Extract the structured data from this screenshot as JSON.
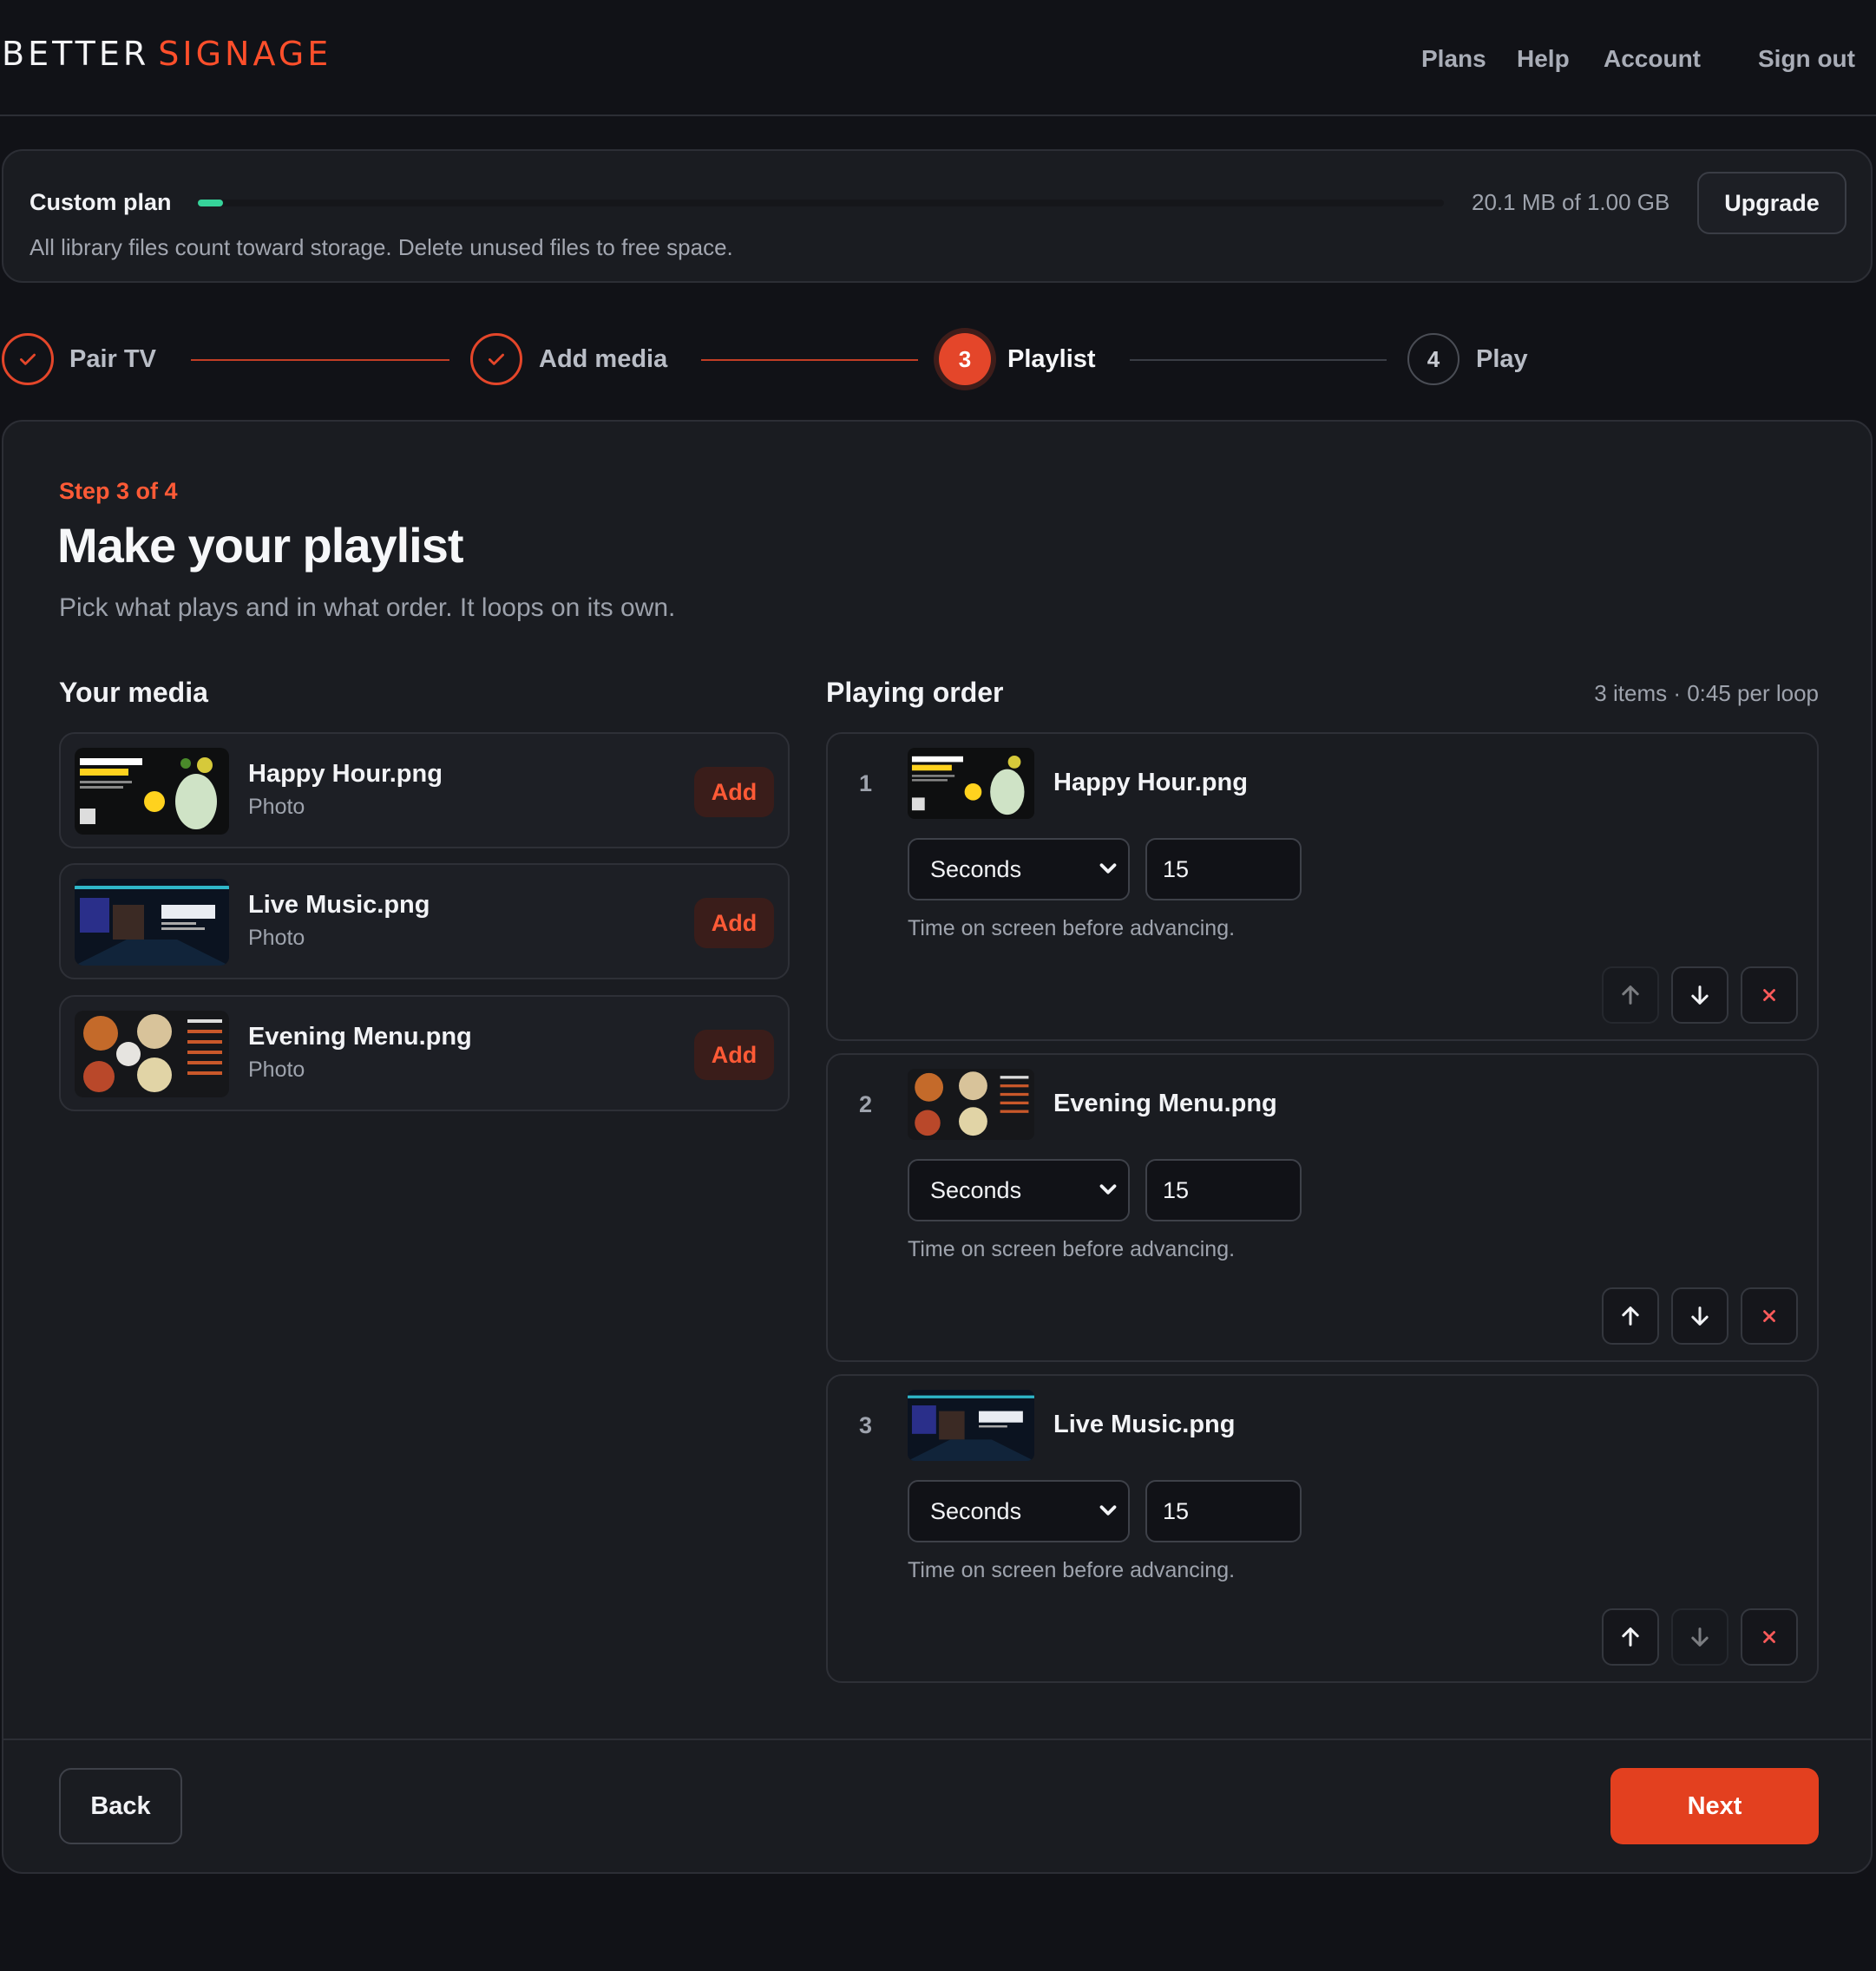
{
  "header": {
    "logo_left": "BETTER",
    "logo_right": "SIGNAGE",
    "nav": [
      "Plans",
      "Help",
      "Account",
      "Sign out"
    ]
  },
  "plan": {
    "name": "Custom plan",
    "usage_text": "20.1 MB of 1.00 GB",
    "usage_fraction": 0.02,
    "upgrade_label": "Upgrade",
    "note": "All library files count toward storage. Delete unused files to free space."
  },
  "stepper": {
    "steps": [
      {
        "label": "Pair TV",
        "state": "done",
        "icon": "check-icon"
      },
      {
        "label": "Add media",
        "state": "done",
        "icon": "check-icon"
      },
      {
        "label": "Playlist",
        "state": "active",
        "number": "3"
      },
      {
        "label": "Play",
        "state": "todo",
        "number": "4"
      }
    ]
  },
  "main": {
    "eyebrow": "Step 3 of 4",
    "title": "Make your playlist",
    "subtitle": "Pick what plays and in what order. It loops on its own.",
    "media_heading": "Your media",
    "order_heading": "Playing order",
    "order_meta": "3 items · 0:45 per loop",
    "add_label": "Add",
    "media": [
      {
        "name": "Happy Hour.png",
        "type": "Photo",
        "thumb": "happy-hour-thumbnail"
      },
      {
        "name": "Live Music.png",
        "type": "Photo",
        "thumb": "live-music-thumbnail"
      },
      {
        "name": "Evening Menu.png",
        "type": "Photo",
        "thumb": "evening-menu-thumbnail"
      }
    ],
    "playlist": [
      {
        "index": "1",
        "name": "Happy Hour.png",
        "unit": "Seconds",
        "duration": "15",
        "help": "Time on screen before advancing.",
        "up_enabled": false,
        "down_enabled": true
      },
      {
        "index": "2",
        "name": "Evening Menu.png",
        "unit": "Seconds",
        "duration": "15",
        "help": "Time on screen before advancing.",
        "up_enabled": true,
        "down_enabled": true
      },
      {
        "index": "3",
        "name": "Live Music.png",
        "unit": "Seconds",
        "duration": "15",
        "help": "Time on screen before advancing.",
        "up_enabled": true,
        "down_enabled": false
      }
    ]
  },
  "footer": {
    "back_label": "Back",
    "next_label": "Next"
  },
  "colors": {
    "accent": "#e4462a",
    "storage_bar": "#36d39a",
    "background": "#111217"
  }
}
